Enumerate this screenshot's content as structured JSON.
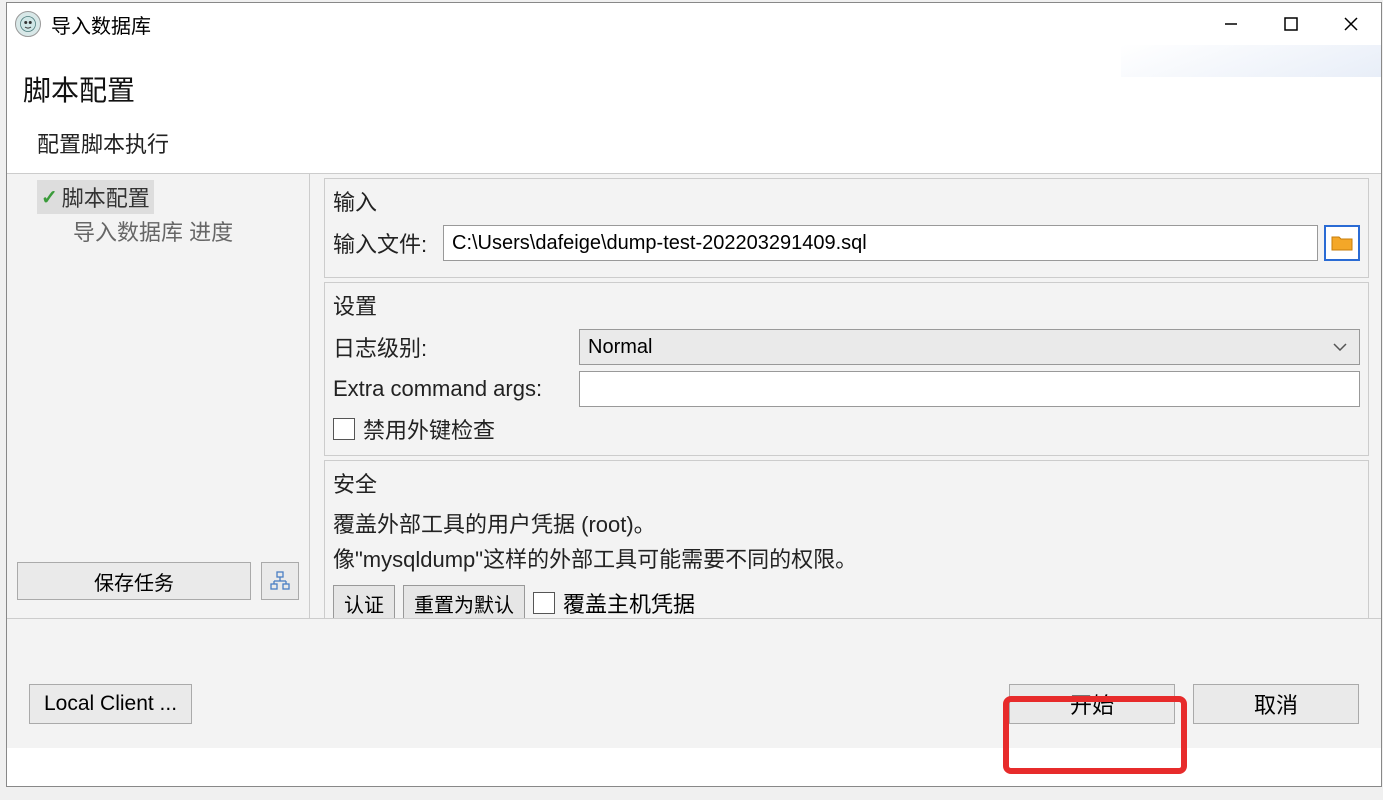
{
  "window": {
    "title": "导入数据库"
  },
  "header": {
    "title": "脚本配置",
    "subtitle": "配置脚本执行"
  },
  "nav": {
    "items": [
      {
        "label": "脚本配置",
        "active": true,
        "hasCheck": true
      },
      {
        "label": "导入数据库 进度",
        "active": false,
        "hasCheck": false
      }
    ],
    "saveTask": "保存任务"
  },
  "groups": {
    "input": {
      "title": "输入",
      "fileLabel": "输入文件:",
      "fileValue": "C:\\Users\\dafeige\\dump-test-202203291409.sql"
    },
    "settings": {
      "title": "设置",
      "logLevelLabel": "日志级别:",
      "logLevelValue": "Normal",
      "extraArgsLabel": "Extra command args:",
      "extraArgsValue": "",
      "disableFkLabel": "禁用外键检查"
    },
    "security": {
      "title": "安全",
      "line1": "覆盖外部工具的用户凭据 (root)。",
      "line2": "像\"mysqldump\"这样的外部工具可能需要不同的权限。",
      "authBtn": "认证",
      "resetBtn": "重置为默认",
      "overrideHostLabel": "覆盖主机凭据"
    }
  },
  "footer": {
    "localClient": "Local Client ...",
    "start": "开始",
    "cancel": "取消"
  }
}
